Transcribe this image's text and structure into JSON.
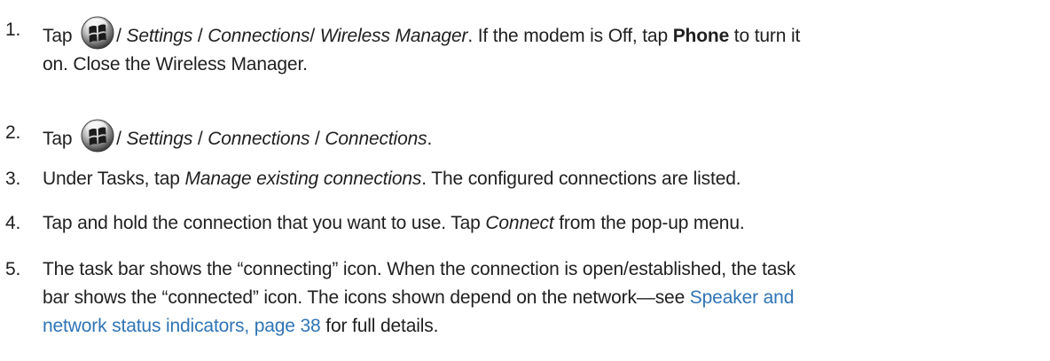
{
  "steps": [
    {
      "number": "1.",
      "text_tap": "Tap",
      "path_1": "/ ",
      "settings": "Settings",
      "sep_1": " / ",
      "connections": "Connections",
      "sep_2": "/ ",
      "wireless_manager": "Wireless Manager",
      "text_mid": ". If the modem is Off, tap ",
      "phone": "Phone",
      "text_end_line1": " to turn it",
      "line2": "on. Close the Wireless Manager."
    },
    {
      "number": "2.",
      "text_tap": "Tap",
      "path_1": "/ ",
      "settings": "Settings",
      "sep_1": " / ",
      "connections": "Connections",
      "sep_2": " / ",
      "connections_2": "Connections",
      "end": "."
    },
    {
      "number": "3.",
      "text_1": "Under Tasks, tap ",
      "manage": "Manage existing connections",
      "text_2": ". The configured connections are listed."
    },
    {
      "number": "4.",
      "text_1": "Tap and hold the connection that you want to use. Tap ",
      "connect": "Connect",
      "text_2": " from the pop-up menu."
    },
    {
      "number": "5.",
      "line1": "The task bar shows the “connecting” icon. When the connection is open/established, the task",
      "line2_text": "bar shows the “connected” icon. The icons shown depend on the network—see ",
      "line2_link": "Speaker and",
      "line3_link": "network status indicators, page 38",
      "line3_text": " for full details."
    }
  ],
  "icons": {
    "start": "windows-start-icon"
  },
  "colors": {
    "text": "#1f1f1f",
    "link": "#2f74b5"
  }
}
